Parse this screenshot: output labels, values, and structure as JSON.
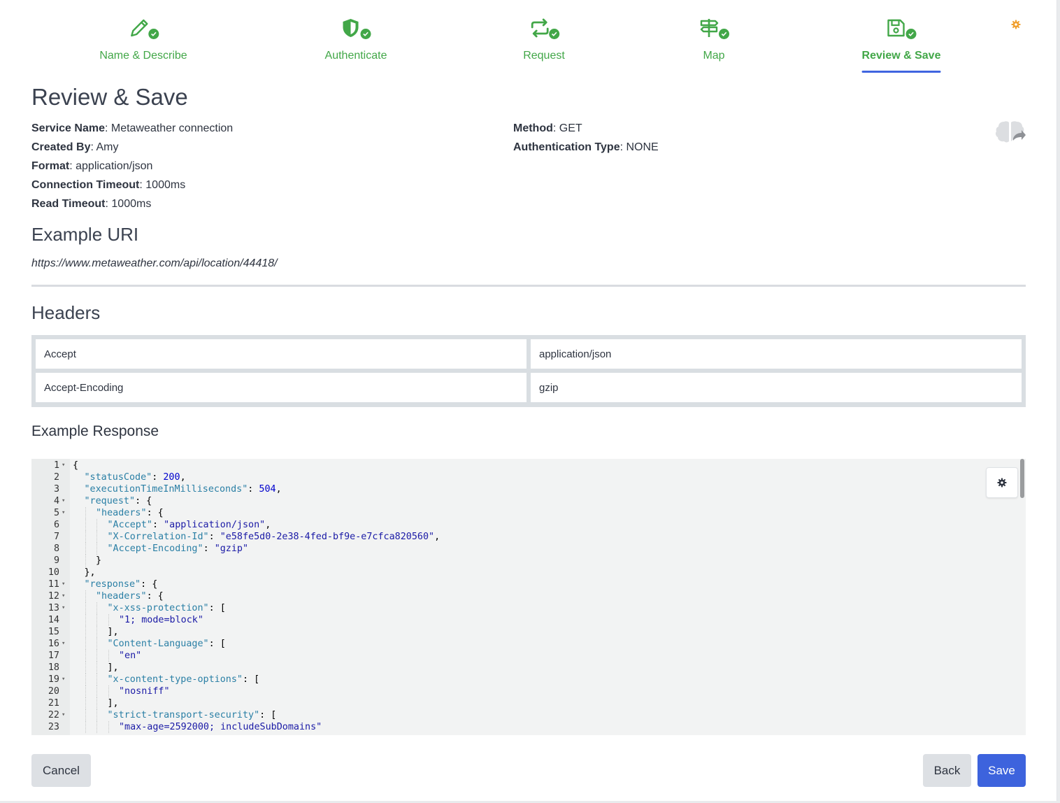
{
  "stepper": {
    "steps": [
      {
        "label": "Name & Describe",
        "icon": "pencil-icon"
      },
      {
        "label": "Authenticate",
        "icon": "shield-icon"
      },
      {
        "label": "Request",
        "icon": "repeat-icon"
      },
      {
        "label": "Map",
        "icon": "signpost-icon"
      },
      {
        "label": "Review & Save",
        "icon": "floppy-icon",
        "active": true
      }
    ],
    "accent": "#42a748",
    "active_underline": "#4065e0",
    "settings_icon": "gear-icon",
    "settings_color": "#f0a030"
  },
  "page": {
    "title": "Review & Save"
  },
  "summary": {
    "service_name": {
      "label": "Service Name",
      "value": "Metaweather connection"
    },
    "created_by": {
      "label": "Created By",
      "value": "Amy"
    },
    "format": {
      "label": "Format",
      "value": "application/json"
    },
    "connection_timeout": {
      "label": "Connection Timeout",
      "value": "1000ms"
    },
    "read_timeout": {
      "label": "Read Timeout",
      "value": "1000ms"
    },
    "method": {
      "label": "Method",
      "value": "GET"
    },
    "auth_type": {
      "label": "Authentication Type",
      "value": "NONE"
    },
    "export_icon": "brain-share-icon"
  },
  "example_uri": {
    "heading": "Example URI",
    "value": "https://www.metaweather.com/api/location/44418/"
  },
  "headers": {
    "heading": "Headers",
    "rows": [
      {
        "name": "Accept",
        "value": "application/json"
      },
      {
        "name": "Accept-Encoding",
        "value": "gzip"
      }
    ]
  },
  "example_response": {
    "heading": "Example Response",
    "lines": [
      {
        "n": "1",
        "fold": true,
        "indent": 0,
        "text": "{"
      },
      {
        "n": "2",
        "fold": false,
        "indent": 1,
        "key": "\"statusCode\"",
        "rest": ": ",
        "num": "200",
        "tail": ","
      },
      {
        "n": "3",
        "fold": false,
        "indent": 1,
        "key": "\"executionTimeInMilliseconds\"",
        "rest": ": ",
        "num": "504",
        "tail": ","
      },
      {
        "n": "4",
        "fold": true,
        "indent": 1,
        "key": "\"request\"",
        "rest": ": {"
      },
      {
        "n": "5",
        "fold": true,
        "indent": 2,
        "key": "\"headers\"",
        "rest": ": {"
      },
      {
        "n": "6",
        "fold": false,
        "indent": 3,
        "key": "\"Accept\"",
        "rest": ": ",
        "str": "\"application/json\"",
        "tail": ","
      },
      {
        "n": "7",
        "fold": false,
        "indent": 3,
        "key": "\"X-Correlation-Id\"",
        "rest": ": ",
        "str": "\"e58fe5d0-2e38-4fed-bf9e-e7cfca820560\"",
        "tail": ","
      },
      {
        "n": "8",
        "fold": false,
        "indent": 3,
        "key": "\"Accept-Encoding\"",
        "rest": ": ",
        "str": "\"gzip\""
      },
      {
        "n": "9",
        "fold": false,
        "indent": 2,
        "text": "}"
      },
      {
        "n": "10",
        "fold": false,
        "indent": 1,
        "text": "},"
      },
      {
        "n": "11",
        "fold": true,
        "indent": 1,
        "key": "\"response\"",
        "rest": ": {"
      },
      {
        "n": "12",
        "fold": true,
        "indent": 2,
        "key": "\"headers\"",
        "rest": ": {"
      },
      {
        "n": "13",
        "fold": true,
        "indent": 3,
        "key": "\"x-xss-protection\"",
        "rest": ": ["
      },
      {
        "n": "14",
        "fold": false,
        "indent": 4,
        "str": "\"1; mode=block\""
      },
      {
        "n": "15",
        "fold": false,
        "indent": 3,
        "text": "],"
      },
      {
        "n": "16",
        "fold": true,
        "indent": 3,
        "key": "\"Content-Language\"",
        "rest": ": ["
      },
      {
        "n": "17",
        "fold": false,
        "indent": 4,
        "str": "\"en\""
      },
      {
        "n": "18",
        "fold": false,
        "indent": 3,
        "text": "],"
      },
      {
        "n": "19",
        "fold": true,
        "indent": 3,
        "key": "\"x-content-type-options\"",
        "rest": ": ["
      },
      {
        "n": "20",
        "fold": false,
        "indent": 4,
        "str": "\"nosniff\""
      },
      {
        "n": "21",
        "fold": false,
        "indent": 3,
        "text": "],"
      },
      {
        "n": "22",
        "fold": true,
        "indent": 3,
        "key": "\"strict-transport-security\"",
        "rest": ": ["
      },
      {
        "n": "23",
        "fold": false,
        "indent": 4,
        "str": "\"max-age=2592000; includeSubDomains\""
      }
    ]
  },
  "buttons": {
    "cancel": "Cancel",
    "back": "Back",
    "save": "Save"
  }
}
